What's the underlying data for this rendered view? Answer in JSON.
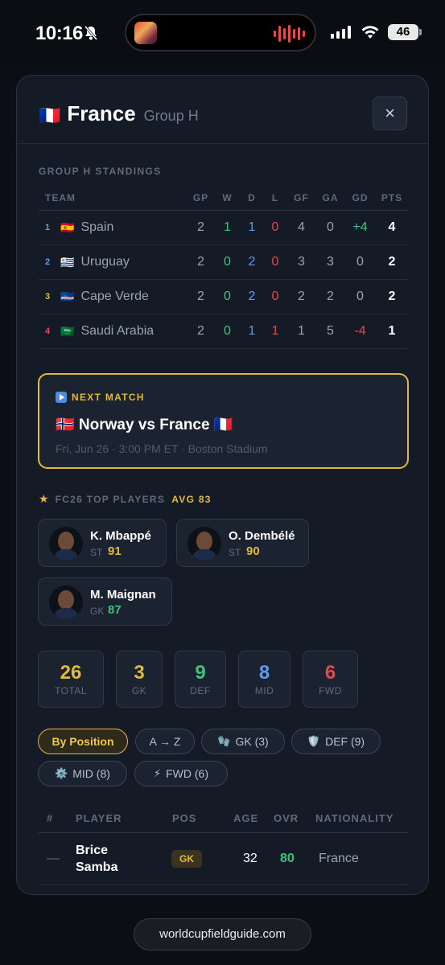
{
  "status_bar": {
    "time": "10:16",
    "battery": "46"
  },
  "modal": {
    "flag": "🇫🇷",
    "country": "France",
    "group": "Group H",
    "close_label": "×"
  },
  "standings": {
    "title": "GROUP H STANDINGS",
    "columns": [
      "TEAM",
      "GP",
      "W",
      "D",
      "L",
      "GF",
      "GA",
      "GD",
      "PTS"
    ],
    "rows": [
      {
        "rank": "1",
        "flag": "🇪🇸",
        "team": "Spain",
        "gp": "2",
        "w": "1",
        "d": "1",
        "l": "0",
        "gf": "4",
        "ga": "0",
        "gd": "+4",
        "pts": "4"
      },
      {
        "rank": "2",
        "flag": "🇺🇾",
        "team": "Uruguay",
        "gp": "2",
        "w": "0",
        "d": "2",
        "l": "0",
        "gf": "3",
        "ga": "3",
        "gd": "0",
        "pts": "2"
      },
      {
        "rank": "3",
        "flag": "🇨🇻",
        "team": "Cape Verde",
        "gp": "2",
        "w": "0",
        "d": "2",
        "l": "0",
        "gf": "2",
        "ga": "2",
        "gd": "0",
        "pts": "2"
      },
      {
        "rank": "4",
        "flag": "🇸🇦",
        "team": "Saudi Arabia",
        "gp": "2",
        "w": "0",
        "d": "1",
        "l": "1",
        "gf": "1",
        "ga": "5",
        "gd": "-4",
        "pts": "1"
      }
    ],
    "rank_colors": [
      "#3ec37a",
      "#5b9bf0",
      "#e3b93a",
      "#e5484d"
    ]
  },
  "next_match": {
    "label": "NEXT MATCH",
    "teams": "🇳🇴 Norway vs France 🇫🇷",
    "meta": "Fri, Jun 26 · 3:00 PM ET  ·  Boston Stadium"
  },
  "top_players": {
    "label": "FC26 TOP PLAYERS",
    "avg": "AVG 83",
    "players": [
      {
        "name": "K. Mbappé",
        "pos": "ST",
        "ovr": "91"
      },
      {
        "name": "O. Dembélé",
        "pos": "ST",
        "ovr": "90"
      },
      {
        "name": "M. Maignan",
        "pos": "GK",
        "ovr": "87"
      }
    ]
  },
  "stats": [
    {
      "value": "26",
      "label": "TOTAL",
      "color": "#e3b93a"
    },
    {
      "value": "3",
      "label": "GK",
      "color": "#e3b93a"
    },
    {
      "value": "9",
      "label": "DEF",
      "color": "#3ec37a"
    },
    {
      "value": "8",
      "label": "MID",
      "color": "#5b9bf0"
    },
    {
      "value": "6",
      "label": "FWD",
      "color": "#e5484d"
    }
  ],
  "filters": [
    {
      "label": "By Position",
      "icon": ""
    },
    {
      "label": "A → Z",
      "icon": ""
    },
    {
      "label": "GK (3)",
      "icon": "🧤"
    },
    {
      "label": "DEF (9)",
      "icon": "🛡️"
    },
    {
      "label": "MID (8)",
      "icon": "⚙️"
    },
    {
      "label": "FWD (6)",
      "icon": "⚡"
    }
  ],
  "roster": {
    "columns": [
      "#",
      "PLAYER",
      "POS",
      "AGE",
      "OVR",
      "NATIONALITY"
    ],
    "rows": [
      {
        "number": "—",
        "name_line1": "Brice",
        "name_line2": "Samba",
        "pos": "GK",
        "age": "32",
        "ovr": "80",
        "nationality": "France"
      }
    ]
  },
  "url": "worldcupfieldguide.com"
}
